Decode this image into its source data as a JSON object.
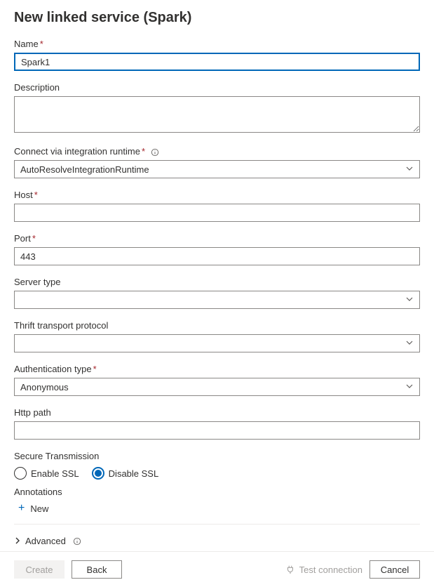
{
  "header": {
    "title": "New linked service (Spark)"
  },
  "fields": {
    "name": {
      "label": "Name",
      "value": "Spark1"
    },
    "description": {
      "label": "Description",
      "value": ""
    },
    "runtime": {
      "label": "Connect via integration runtime",
      "value": "AutoResolveIntegrationRuntime"
    },
    "host": {
      "label": "Host",
      "value": ""
    },
    "port": {
      "label": "Port",
      "value": "443"
    },
    "serverType": {
      "label": "Server type",
      "value": ""
    },
    "thrift": {
      "label": "Thrift transport protocol",
      "value": ""
    },
    "authType": {
      "label": "Authentication type",
      "value": "Anonymous"
    },
    "httpPath": {
      "label": "Http path",
      "value": ""
    }
  },
  "secure": {
    "label": "Secure Transmission",
    "options": {
      "enable": "Enable SSL",
      "disable": "Disable SSL"
    },
    "selected": "disable"
  },
  "annotations": {
    "label": "Annotations",
    "new": "New"
  },
  "advanced": {
    "label": "Advanced"
  },
  "footer": {
    "create": "Create",
    "back": "Back",
    "test": "Test connection",
    "cancel": "Cancel"
  }
}
